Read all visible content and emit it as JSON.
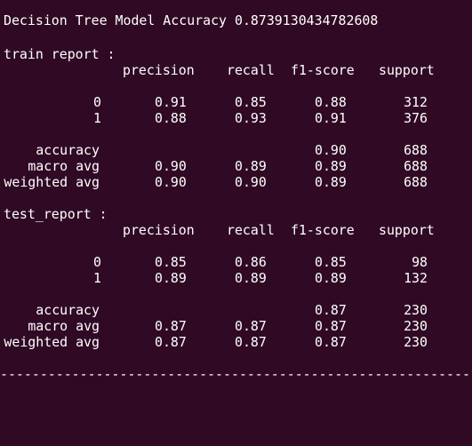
{
  "title_line": "Decision Tree Model Accuracy 0.8739130434782608",
  "train": {
    "label": "train report :",
    "headers": {
      "precision": "precision",
      "recall": "recall",
      "f1": "f1-score",
      "support": "support"
    },
    "rows": [
      {
        "label": "0",
        "precision": "0.91",
        "recall": "0.85",
        "f1": "0.88",
        "support": "312"
      },
      {
        "label": "1",
        "precision": "0.88",
        "recall": "0.93",
        "f1": "0.91",
        "support": "376"
      }
    ],
    "accuracy": {
      "label": "accuracy",
      "f1": "0.90",
      "support": "688"
    },
    "macro": {
      "label": "macro avg",
      "precision": "0.90",
      "recall": "0.89",
      "f1": "0.89",
      "support": "688"
    },
    "weighted": {
      "label": "weighted avg",
      "precision": "0.90",
      "recall": "0.90",
      "f1": "0.89",
      "support": "688"
    }
  },
  "test": {
    "label": "test_report :",
    "headers": {
      "precision": "precision",
      "recall": "recall",
      "f1": "f1-score",
      "support": "support"
    },
    "rows": [
      {
        "label": "0",
        "precision": "0.85",
        "recall": "0.86",
        "f1": "0.85",
        "support": "98"
      },
      {
        "label": "1",
        "precision": "0.89",
        "recall": "0.89",
        "f1": "0.89",
        "support": "132"
      }
    ],
    "accuracy": {
      "label": "accuracy",
      "f1": "0.87",
      "support": "230"
    },
    "macro": {
      "label": "macro avg",
      "precision": "0.87",
      "recall": "0.87",
      "f1": "0.87",
      "support": "230"
    },
    "weighted": {
      "label": "weighted avg",
      "precision": "0.87",
      "recall": "0.87",
      "f1": "0.87",
      "support": "230"
    }
  },
  "separator": "---------------------------------------------------------------------------"
}
